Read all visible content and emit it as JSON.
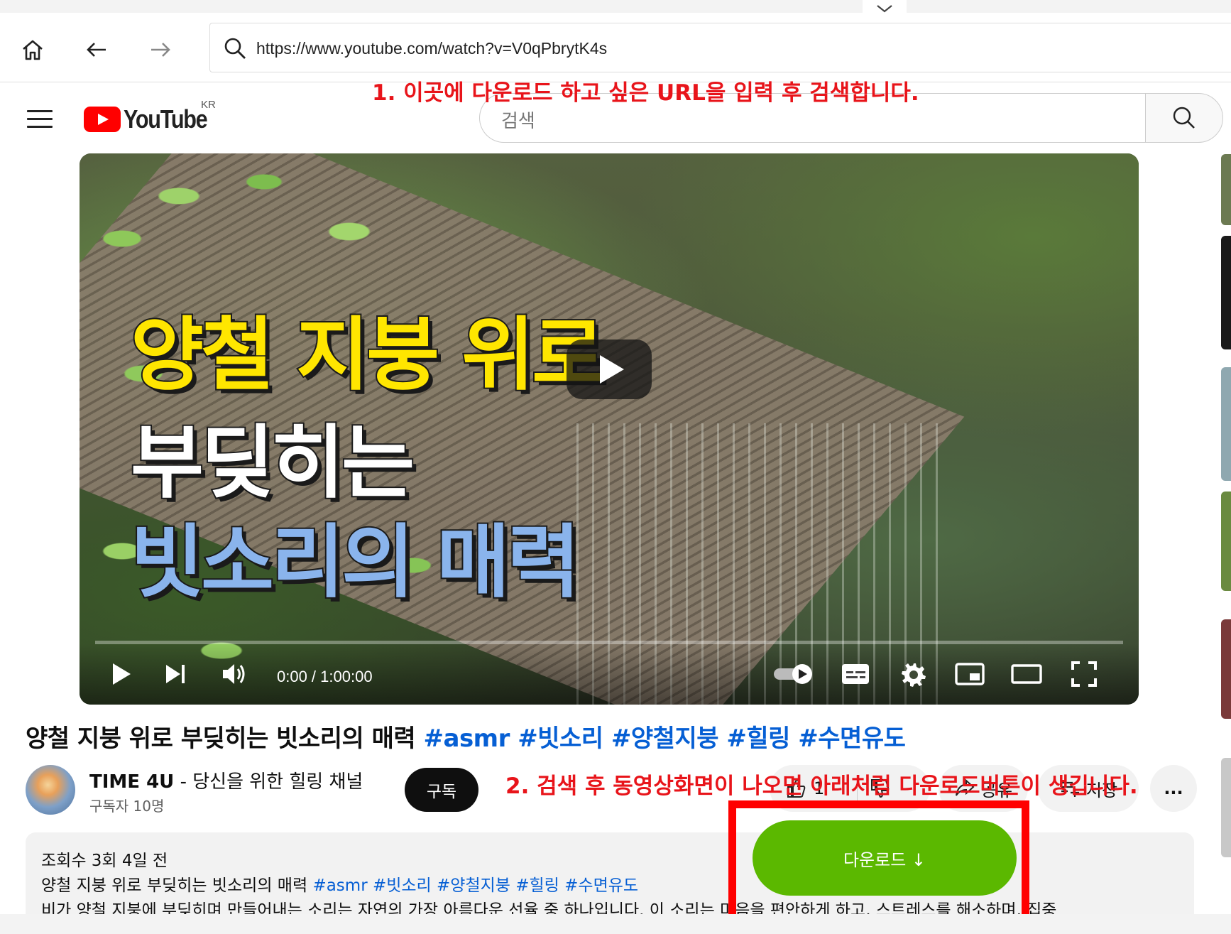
{
  "browser": {
    "url": "https://www.youtube.com/watch?v=V0qPbrytK4s"
  },
  "youtube": {
    "logo_text": "YouTube",
    "region": "KR",
    "search_placeholder": "검색"
  },
  "annotations": {
    "step1": "1. 이곳에 다운로드 하고 싶은 URL을 입력 후 검색합니다.",
    "step2": "2. 검색 후 동영상화면이 나오면 아래처럼 다운로드버튼이 생깁니다."
  },
  "player": {
    "thumbnail_lines": [
      "양철 지붕 위로",
      "부딪히는",
      "빗소리의 매력"
    ],
    "time": "0:00 / 1:00:00",
    "progress": 0
  },
  "video": {
    "title": "양철 지붕 위로 부딪히는 빗소리의 매력",
    "hashtags": [
      "#asmr",
      "#빗소리",
      "#양철지붕",
      "#힐링",
      "#수면유도"
    ]
  },
  "channel": {
    "name": "TIME 4U",
    "tagline": " - 당신을 위한 힐링 채널",
    "subscribers": "구독자 10명",
    "subscribe_label": "구독"
  },
  "actions": {
    "like_count": "1",
    "share_label": "공유",
    "save_label": "저장",
    "more_label": "..."
  },
  "description": {
    "stats": "조회수 3회  4일 전",
    "line1": "양철 지붕 위로 부딪히는 빗소리의 매력",
    "line1_tags": "#asmr #빗소리 #양철지붕 #힐링 #수면유도",
    "line2": "비가 양철 지붕에 부딪히며 만들어내는 소리는 자연의 가장 아름다운 선율 중 하나입니다. 이 소리는 마음을 편안하게 하고, 스트레스를 해소하며, 집중"
  },
  "download": {
    "label": "다운로드 ↓",
    "color": "#5bb800",
    "frame_color": "#ff0000"
  }
}
